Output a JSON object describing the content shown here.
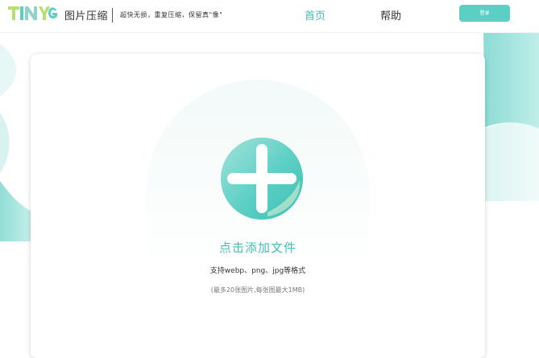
{
  "header": {
    "brand": "图片压缩",
    "slogan": "超快无损，重复压缩，保留真\"像\"",
    "nav_home": "首页",
    "nav_help": "帮助",
    "login": "登录"
  },
  "upload": {
    "title": "点击添加文件",
    "formats": "支持webp、png、jpg等格式",
    "limits": "(最多20张图片,每张图最大1MB)"
  },
  "colors": {
    "accent": "#45bdb4",
    "button": "#5ccfc4"
  }
}
